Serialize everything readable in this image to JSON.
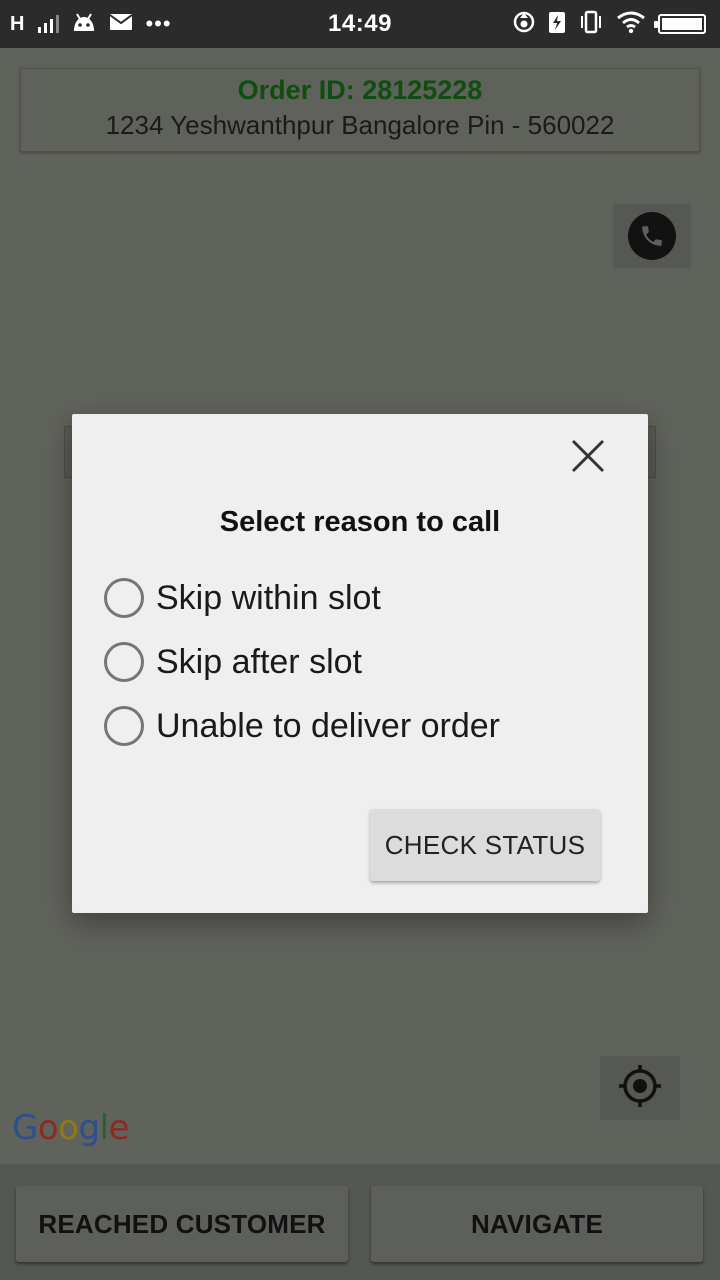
{
  "status_bar": {
    "signal_label": "H",
    "time": "14:49",
    "icons": [
      "signal-icon",
      "android-icon",
      "mail-icon",
      "more-dots-icon",
      "sync-icon",
      "charging-icon",
      "vibrate-icon",
      "wifi-icon",
      "battery-icon"
    ]
  },
  "order": {
    "id_label": "Order ID: 28125228",
    "address": "1234 Yeshwanthpur Bangalore Pin - 560022"
  },
  "map": {
    "attribution": [
      "G",
      "o",
      "o",
      "g",
      "l",
      "e"
    ]
  },
  "dialog": {
    "title": "Select reason to call",
    "options": [
      {
        "label": "Skip within slot",
        "selected": false
      },
      {
        "label": "Skip after slot",
        "selected": false
      },
      {
        "label": "Unable to deliver order",
        "selected": false
      }
    ],
    "action_label": "CHECK STATUS"
  },
  "bottom_bar": {
    "reached_label": "REACHED CUSTOMER",
    "navigate_label": "NAVIGATE"
  },
  "colors": {
    "status_bar_bg": "#2b2b2b",
    "scrim": "#60625c",
    "order_id_green": "#0f4e0f",
    "dialog_bg": "#efefef"
  }
}
